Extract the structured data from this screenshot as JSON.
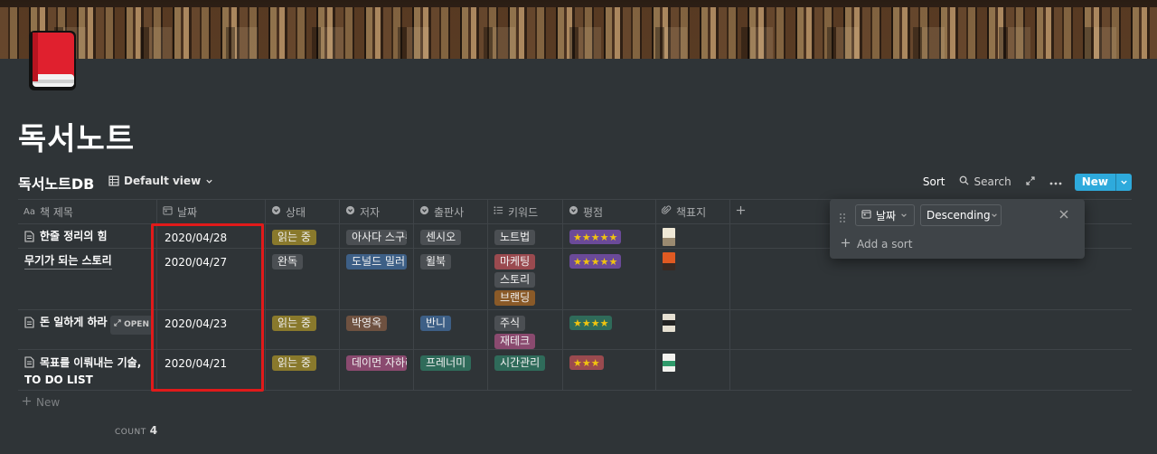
{
  "page": {
    "title": "독서노트"
  },
  "database": {
    "title": "독서노트DB",
    "view_label": "Default view"
  },
  "toolbar": {
    "sort_label": "Sort",
    "search_label": "Search",
    "new_label": "New",
    "accent_color": "#2eaadc"
  },
  "columns": [
    {
      "label": "책 제목",
      "icon": "text-aa-icon"
    },
    {
      "label": "날짜",
      "icon": "calendar-icon"
    },
    {
      "label": "상태",
      "icon": "select-icon"
    },
    {
      "label": "저자",
      "icon": "select-icon"
    },
    {
      "label": "출판사",
      "icon": "select-icon"
    },
    {
      "label": "키워드",
      "icon": "multi-select-icon"
    },
    {
      "label": "평점",
      "icon": "select-icon"
    },
    {
      "label": "책표지",
      "icon": "paperclip-icon"
    }
  ],
  "rows": [
    {
      "title": "한줄 정리의 힘",
      "date": "2020/04/28",
      "status": {
        "label": "읽는 중",
        "color": "#89792c"
      },
      "author": {
        "label": "아사다 스구루",
        "color": "#4b4f53"
      },
      "publisher": {
        "label": "센시오",
        "color": "#4b4f53"
      },
      "keywords": [
        {
          "label": "노트법",
          "color": "#4b4f53"
        }
      ],
      "rating": {
        "stars": 5,
        "text": "★★★★★",
        "color": "#6b4a99"
      },
      "cover_color": "#d8cfb8"
    },
    {
      "title": "무기가 되는 스토리",
      "date": "2020/04/27",
      "status": {
        "label": "완독",
        "color": "#4b4f53"
      },
      "author": {
        "label": "도널드 밀러",
        "color": "#3d5f86"
      },
      "publisher": {
        "label": "윌북",
        "color": "#4b4f53"
      },
      "keywords": [
        {
          "label": "마케팅",
          "color": "#9a4a4f"
        },
        {
          "label": "스토리",
          "color": "#4b4f53"
        },
        {
          "label": "브랜딩",
          "color": "#8a5a28"
        }
      ],
      "rating": {
        "stars": 5,
        "text": "★★★★★",
        "color": "#6b4a99"
      },
      "cover_color": "#e05a22"
    },
    {
      "title": "돈 일하게 하라",
      "date": "2020/04/23",
      "status": {
        "label": "읽는 중",
        "color": "#89792c"
      },
      "author": {
        "label": "박영옥",
        "color": "#6e5140"
      },
      "publisher": {
        "label": "반니",
        "color": "#3d5f86"
      },
      "keywords": [
        {
          "label": "주식",
          "color": "#4b4f53"
        },
        {
          "label": "재테크",
          "color": "#8a4a6f"
        }
      ],
      "rating": {
        "stars": 4,
        "text": "★★★★",
        "color": "#2f6b5a"
      },
      "cover_color": "#d9d3c7",
      "open_label": "OPEN"
    },
    {
      "title": "목표를 이뤄내는 기술, TO DO LIST",
      "date": "2020/04/21",
      "status": {
        "label": "읽는 중",
        "color": "#89792c"
      },
      "author": {
        "label": "데이먼 자하리아데스",
        "color": "#8a4a6f"
      },
      "publisher": {
        "label": "프레너미",
        "color": "#2f6b5a"
      },
      "keywords": [
        {
          "label": "시간관리",
          "color": "#2f6b5a"
        }
      ],
      "rating": {
        "stars": 3,
        "text": "★★★",
        "color": "#9a4a4f"
      },
      "cover_color": "#2f9a6a"
    }
  ],
  "new_row_label": "New",
  "count": {
    "label": "COUNT",
    "value": "4"
  },
  "sort_popup": {
    "field_label": "날짜",
    "direction_label": "Descending",
    "add_sort_label": "Add a sort"
  },
  "highlight_color": "#e11a1a"
}
